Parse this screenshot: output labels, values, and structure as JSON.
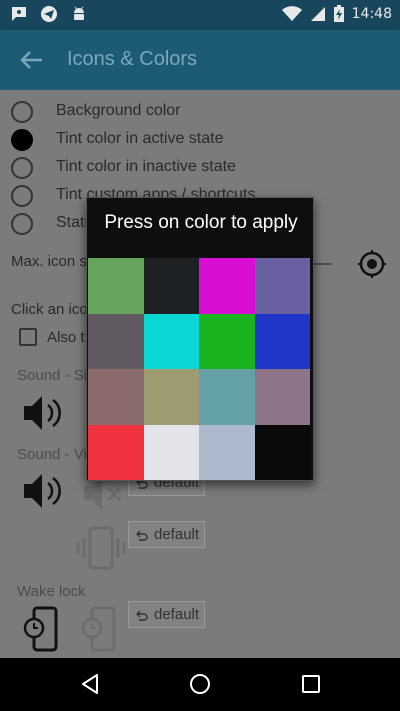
{
  "status_bar": {
    "time": "14:48",
    "icons": [
      "chat-bubble-icon",
      "send-icon",
      "android-icon",
      "wifi-icon",
      "signal-icon",
      "battery-charging-icon"
    ]
  },
  "app_bar": {
    "title": "Icons & Colors",
    "back_icon": "arrow-left-icon"
  },
  "options": [
    {
      "label": "Background color",
      "checked": false
    },
    {
      "label": "Tint color in active state",
      "checked": true
    },
    {
      "label": "Tint color in inactive state",
      "checked": false
    },
    {
      "label": "Tint custom apps / shortcuts",
      "checked": false
    },
    {
      "label": "Status",
      "checked": false
    }
  ],
  "max_icon_label": "Max. icon s",
  "click_icon_label": "Click an ico",
  "also_label": "Also t",
  "sections": {
    "sound_silent": "Sound - Si",
    "sound_vibrate": "Sound - Vi",
    "wake_lock": "Wake lock"
  },
  "default_buttons": [
    "default",
    "default",
    "default"
  ],
  "dialog": {
    "title": "Press on color to apply",
    "colors": [
      "#67a45b",
      "#1d2123",
      "#d80fd3",
      "#6960a1",
      "#625a63",
      "#0ad6d3",
      "#1bb21f",
      "#1e37c9",
      "#8b6b6c",
      "#9e9b72",
      "#64a1a5",
      "#8e7489",
      "#f0333f",
      "#e3e4ea",
      "#adbace",
      "#0a0a0a"
    ]
  },
  "nav": {
    "back": "nav-back-icon",
    "home": "nav-home-icon",
    "recents": "nav-recents-icon"
  }
}
